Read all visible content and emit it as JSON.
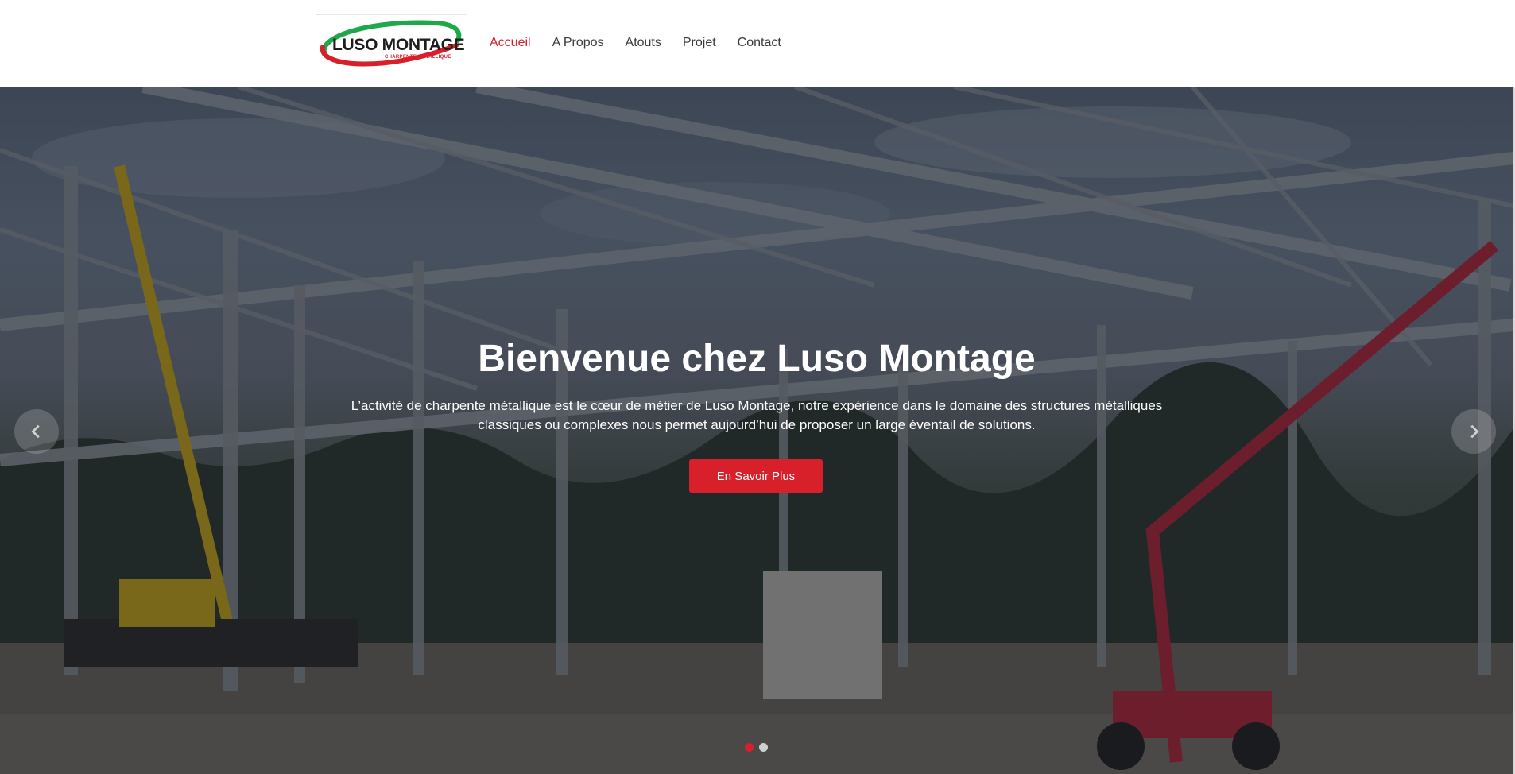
{
  "brand": {
    "name": "LUSO MONTAGE",
    "tagline": "CHARPENTE METALLIQUE",
    "colors": {
      "accent": "#d7202a",
      "logo_green": "#1ea84a"
    }
  },
  "nav": {
    "items": [
      {
        "label": "Accueil",
        "active": true
      },
      {
        "label": "A Propos",
        "active": false
      },
      {
        "label": "Atouts",
        "active": false
      },
      {
        "label": "Projet",
        "active": false
      },
      {
        "label": "Contact",
        "active": false
      }
    ]
  },
  "hero": {
    "title": "Bienvenue chez Luso Montage",
    "text": "L’activité de charpente métallique est le cœur de métier de Luso Montage, notre expérience dans le domaine des structures métalliques classiques ou complexes nous permet aujourd’hui de proposer un large éventail de solutions.",
    "button_label": "En Savoir Plus",
    "prev_icon": "chevron-left-icon",
    "next_icon": "chevron-right-icon",
    "slides": [
      {
        "active": true
      },
      {
        "active": false
      }
    ]
  }
}
